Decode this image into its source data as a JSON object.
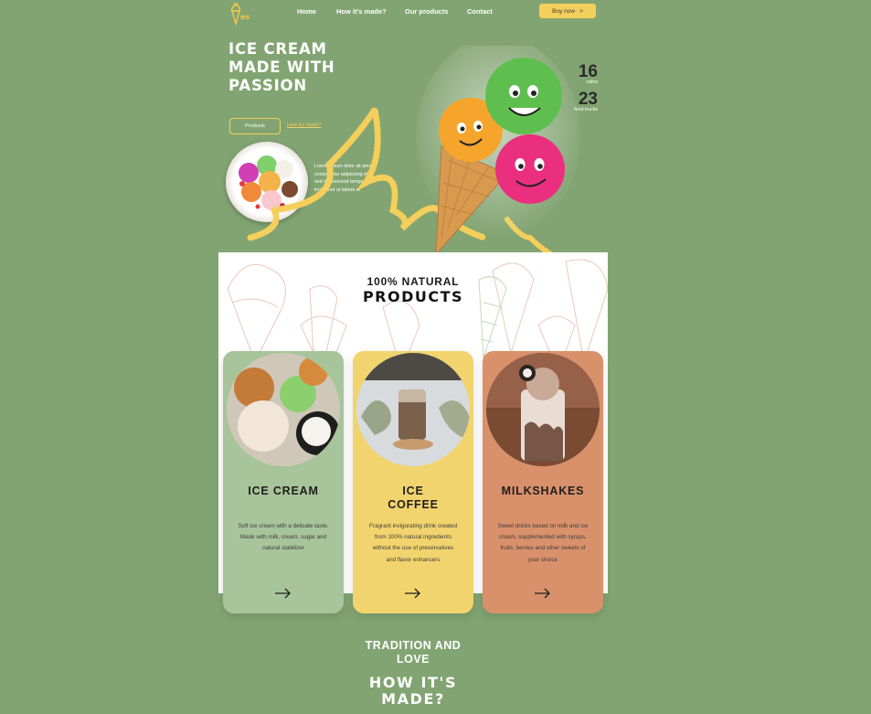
{
  "nav": {
    "logo_text": "es",
    "links": [
      "Home",
      "How it's made?",
      "Our products",
      "Contact"
    ],
    "buy_label": "Buy now",
    "buy_arrow": ">"
  },
  "hero": {
    "title_lines": [
      "ICE CREAM",
      "MADE WITH",
      "PASSION"
    ],
    "products_button": "Products",
    "how_link": "How it's made?",
    "description": "Lorem ipsum dolor sit amet, consectetur adipiscing elit, sed do eiusmod tempor incididunt ut labore et",
    "stats": [
      {
        "number": "16",
        "label": "cafes"
      },
      {
        "number": "23",
        "label": "food trucks"
      }
    ]
  },
  "products": {
    "kicker": "100% NATURAL",
    "title": "PRODUCTS",
    "cards": [
      {
        "title_lines": [
          "ICE CREAM"
        ],
        "text": "Soft ice cream with a delicate taste. Made with milk, cream, sugar and natural stabilizer",
        "color": "#a8c49a"
      },
      {
        "title_lines": [
          "ICE",
          "COFFEE"
        ],
        "text": "Fragrant invigorating drink created from 100% natural ingredients without the use of preservatives and flavor enhancers",
        "color": "#f2d46e"
      },
      {
        "title_lines": [
          "MILKSHAKES"
        ],
        "text": "Sweet drinks based on milk and ice cream, supplemented with syrups, fruits, berries and other sweets of your choice",
        "color": "#d9916b"
      }
    ]
  },
  "section": {
    "tradition_lines": [
      "TRADITION AND",
      "LOVE"
    ],
    "how_lines": [
      "HOW IT'S",
      "MADE?"
    ]
  },
  "colors": {
    "background": "#82a472",
    "accent_yellow": "#f4cf5b",
    "scoop_green": "#5fbf4e",
    "scoop_orange": "#f5a52c",
    "scoop_pink": "#ea2f7e"
  }
}
